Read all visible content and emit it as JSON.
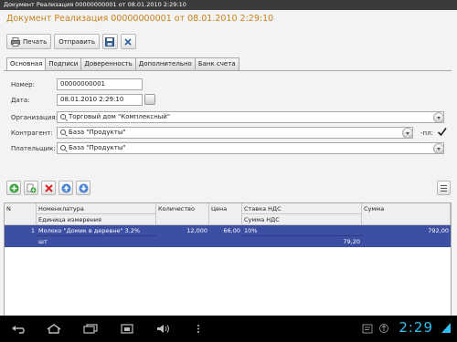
{
  "window": {
    "title": "Документ Реализация 00000000001 от 08.01.2010 2:29:10"
  },
  "document": {
    "title": "Документ Реализация 00000000001 от 08.01.2010 2:29:10"
  },
  "toolbar": {
    "print_label": "Печать",
    "send_label": "Отправить"
  },
  "tabs": [
    {
      "label": "Основная"
    },
    {
      "label": "Подписи"
    },
    {
      "label": "Доверенность"
    },
    {
      "label": "Дополнительно"
    },
    {
      "label": "Банк счета"
    }
  ],
  "form": {
    "number_label": "Номер:",
    "number_value": "00000000001",
    "date_label": "Дата:",
    "date_value": "08.01.2010  2:29:10",
    "org_label": "Организация:",
    "org_value": "Торговый дом  \"Комплексный\"",
    "contractor_label": "Контрагент:",
    "contractor_value": "База \"Продукты\"",
    "pl_label": "-пл:",
    "payer_label": "Плательщик:",
    "payer_value": "База \"Продукты\""
  },
  "table": {
    "headers": {
      "n": "N",
      "nomenclature": "Номенклатура",
      "unit": "Единица измерения",
      "qty": "Количество",
      "price": "Цена",
      "vat_rate": "Ставка НДС",
      "vat_sum": "Сумма НДС",
      "sum": "Сумма"
    },
    "rows": [
      {
        "n": "1",
        "nomenclature": "Молоко \"Домик в деревне\" 3.2%",
        "unit": "шт",
        "qty": "12,000",
        "price": "66,00",
        "vat_rate": "10%",
        "vat_sum": "79,20",
        "sum": "792,00"
      }
    ]
  },
  "statusbar": {
    "time": "2:29"
  },
  "colors": {
    "title_accent": "#c8811a",
    "selection": "#3c4fa3",
    "clock": "#2fc0f0"
  }
}
